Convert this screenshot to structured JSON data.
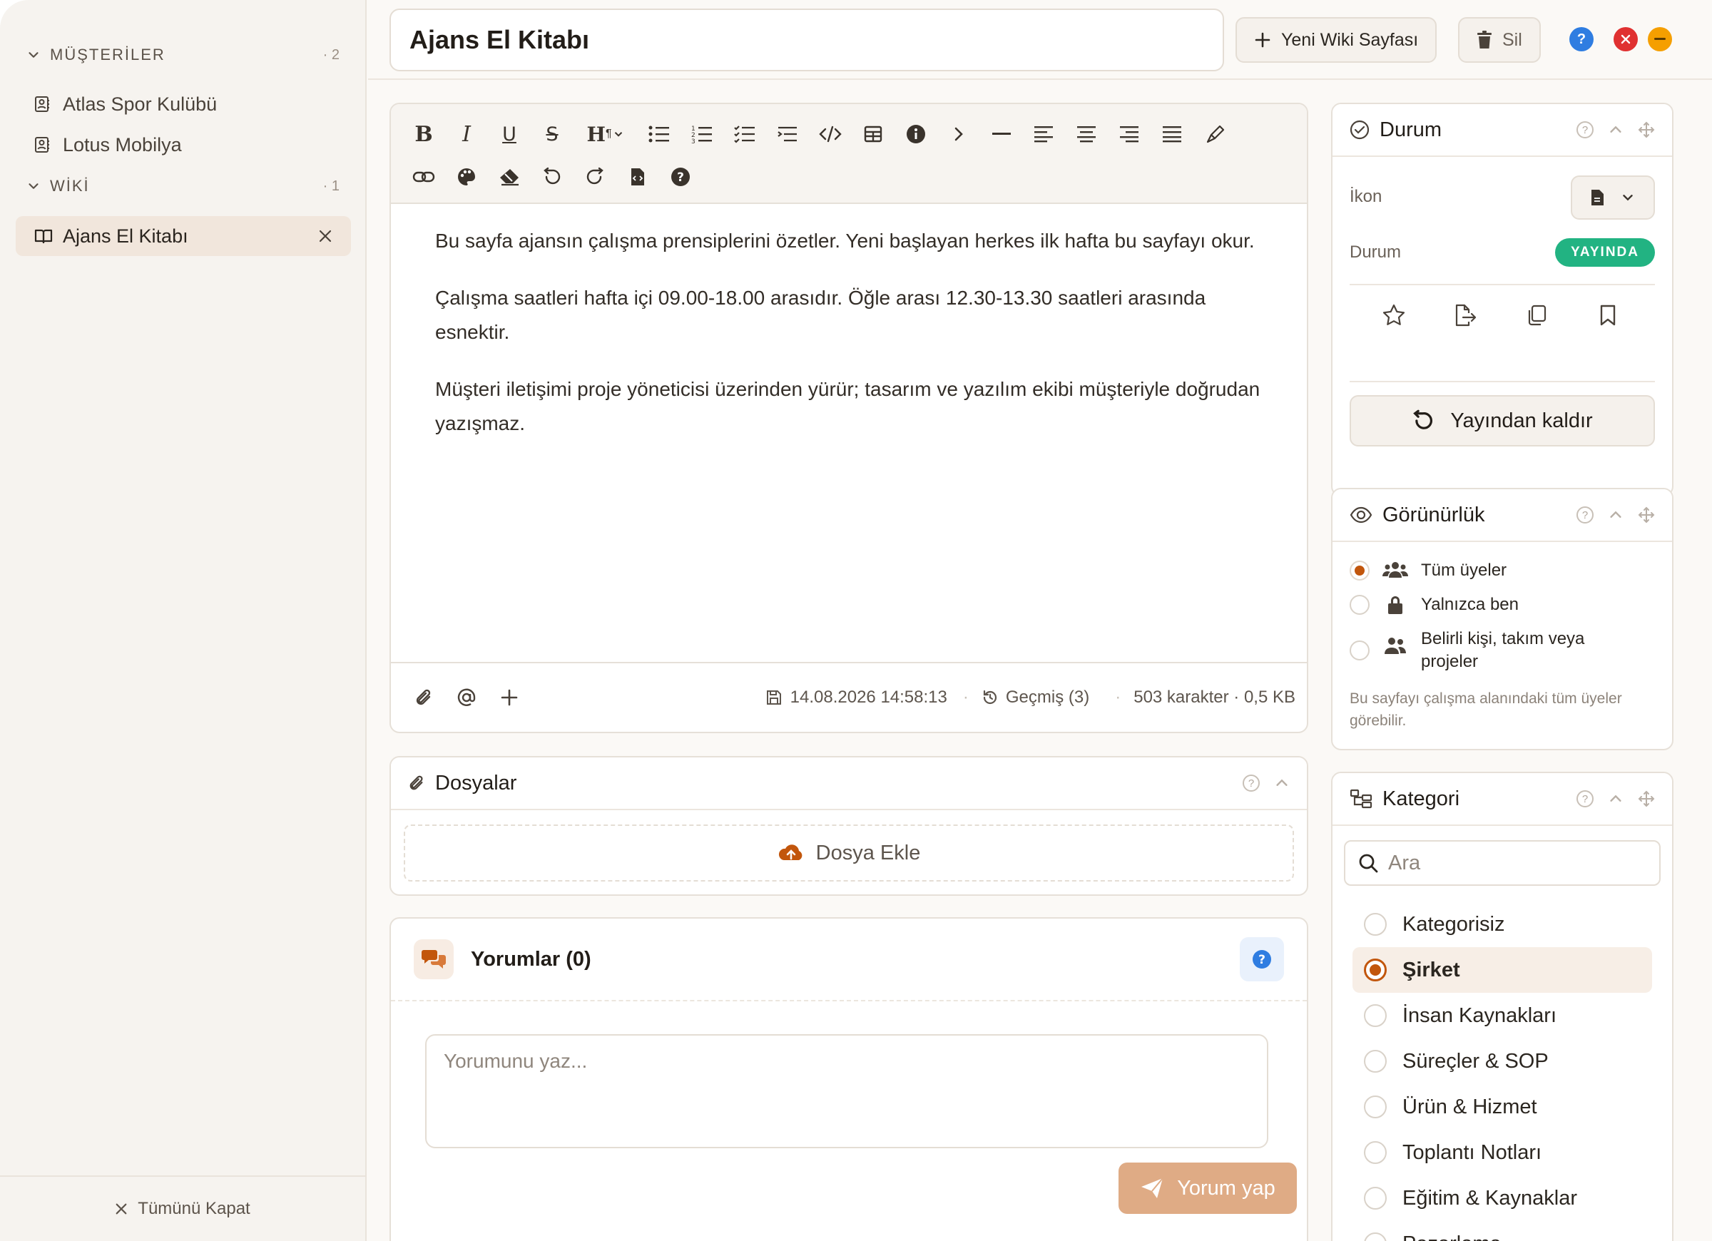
{
  "sidebar": {
    "groups": [
      {
        "label": "MÜŞTERİLER",
        "count": "· 2",
        "items": [
          "Atlas Spor Kulübü",
          "Lotus Mobilya"
        ]
      },
      {
        "label": "WİKİ",
        "count": "· 1",
        "items": [
          "Ajans El Kitabı"
        ]
      }
    ],
    "footer_label": "Tümünü Kapat"
  },
  "topbar": {
    "title": "Ajans El Kitabı",
    "new_page_label": "Yeni Wiki Sayfası",
    "delete_label": "Sil",
    "colors": {
      "help": "#2f7de1",
      "close": "#e03131",
      "minimize": "#f59f00"
    }
  },
  "editor": {
    "paragraphs": [
      "Bu sayfa ajansın çalışma prensiplerini özetler. Yeni başlayan herkes ilk hafta bu sayfayı okur.",
      "Çalışma saatleri hafta içi 09.00-18.00 arasıdır. Öğle arası 12.30-13.30 saatleri arasında esnektir.",
      "Müşteri iletişimi proje yöneticisi üzerinden yürür; tasarım ve yazılım ekibi müşteriyle doğrudan yazışmaz."
    ],
    "saved_at": "14.08.2026 14:58:13",
    "history_label": "Geçmiş (3)",
    "stats": "503 karakter · 0,5 KB"
  },
  "files": {
    "title": "Dosyalar",
    "add_label": "Dosya Ekle"
  },
  "comments": {
    "title": "Yorumlar (0)",
    "placeholder": "Yorumunu yaz...",
    "submit_label": "Yorum yap"
  },
  "status_panel": {
    "title": "Durum",
    "icon_label": "İkon",
    "status_label": "Durum",
    "status_value": "YAYINDA",
    "unpublish_label": "Yayından kaldır"
  },
  "visibility": {
    "title": "Görünürlük",
    "options": [
      "Tüm üyeler",
      "Yalnızca ben",
      "Belirli kişi, takım veya projeler"
    ],
    "selected": 0,
    "hint": "Bu sayfayı çalışma alanındaki tüm üyeler görebilir."
  },
  "category": {
    "title": "Kategori",
    "search_placeholder": "Ara",
    "options": [
      "Kategorisiz",
      "Şirket",
      "İnsan Kaynakları",
      "Süreçler & SOP",
      "Ürün & Hizmet",
      "Toplantı Notları",
      "Eğitim & Kaynaklar",
      "Pazarlama"
    ],
    "selected": 1
  },
  "accent_color": "#c2560c"
}
